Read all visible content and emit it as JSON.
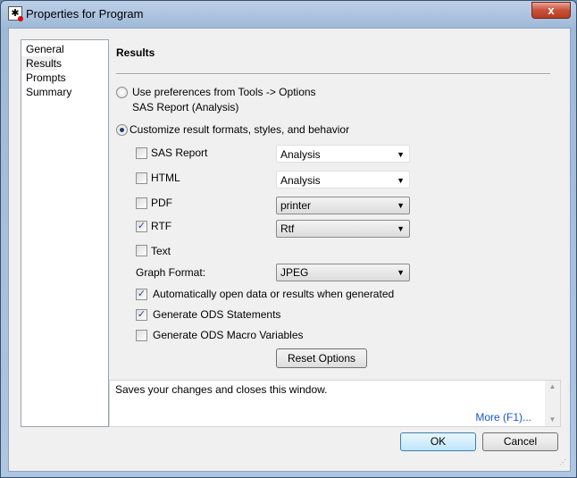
{
  "window": {
    "title": "Properties for Program",
    "close": "x"
  },
  "nav": {
    "items": [
      "General",
      "Results",
      "Prompts",
      "Summary"
    ],
    "selected": "Results"
  },
  "section_title": "Results",
  "use_prefs": {
    "label": "Use preferences from Tools -> Options",
    "sub": "SAS Report (Analysis)",
    "checked": false
  },
  "customize": {
    "label": "Customize result formats, styles, and behavior",
    "checked": true
  },
  "formats": [
    {
      "label": "SAS Report",
      "checked": false,
      "value": "Analysis"
    },
    {
      "label": "HTML",
      "checked": false,
      "value": "Analysis"
    },
    {
      "label": "PDF",
      "checked": false,
      "value": "printer"
    },
    {
      "label": "RTF",
      "checked": true,
      "value": "Rtf"
    },
    {
      "label": "Text",
      "checked": false
    }
  ],
  "graph_format": {
    "label": "Graph Format:",
    "value": "JPEG"
  },
  "options": [
    {
      "label": "Automatically open data or results when generated",
      "checked": true
    },
    {
      "label": "Generate ODS Statements",
      "checked": true
    },
    {
      "label": "Generate ODS Macro Variables",
      "checked": false
    }
  ],
  "reset_label": "Reset Options",
  "help": {
    "text": "Saves your changes and closes this window.",
    "more": "More (F1)..."
  },
  "ok_label": "OK",
  "cancel_label": "Cancel"
}
